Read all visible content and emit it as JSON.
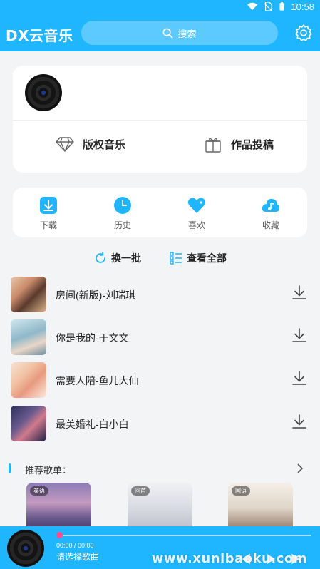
{
  "status": {
    "time": "10:58"
  },
  "header": {
    "app_title": "DX云音乐",
    "search_placeholder": "搜索"
  },
  "profile": {
    "actions": [
      {
        "label": "版权音乐",
        "icon": "diamond-icon"
      },
      {
        "label": "作品投稿",
        "icon": "gift-icon"
      }
    ]
  },
  "quick_actions": [
    {
      "label": "下载",
      "icon": "download-icon"
    },
    {
      "label": "历史",
      "icon": "clock-icon"
    },
    {
      "label": "喜欢",
      "icon": "heart-icon"
    },
    {
      "label": "收藏",
      "icon": "music-cloud-icon"
    }
  ],
  "links": {
    "refresh": "换一批",
    "view_all": "查看全部"
  },
  "songs": [
    {
      "title": "房间(新版)-刘瑞琪"
    },
    {
      "title": "你是我的-于文文"
    },
    {
      "title": "需要人陪-鱼儿大仙"
    },
    {
      "title": "最美婚礼-白小白"
    }
  ],
  "recommend": {
    "title": "推荐歌单：",
    "playlists": [
      {
        "tag": "英语"
      },
      {
        "tag": "回首"
      },
      {
        "tag": "国语"
      }
    ]
  },
  "player": {
    "time": "00:00  /  00:00",
    "title": "请选择歌曲",
    "progress": 0
  },
  "watermark": "www.xunibaoku.com",
  "colors": {
    "accent": "#1fb6ff",
    "progress_dot": "#ff4d8d"
  }
}
